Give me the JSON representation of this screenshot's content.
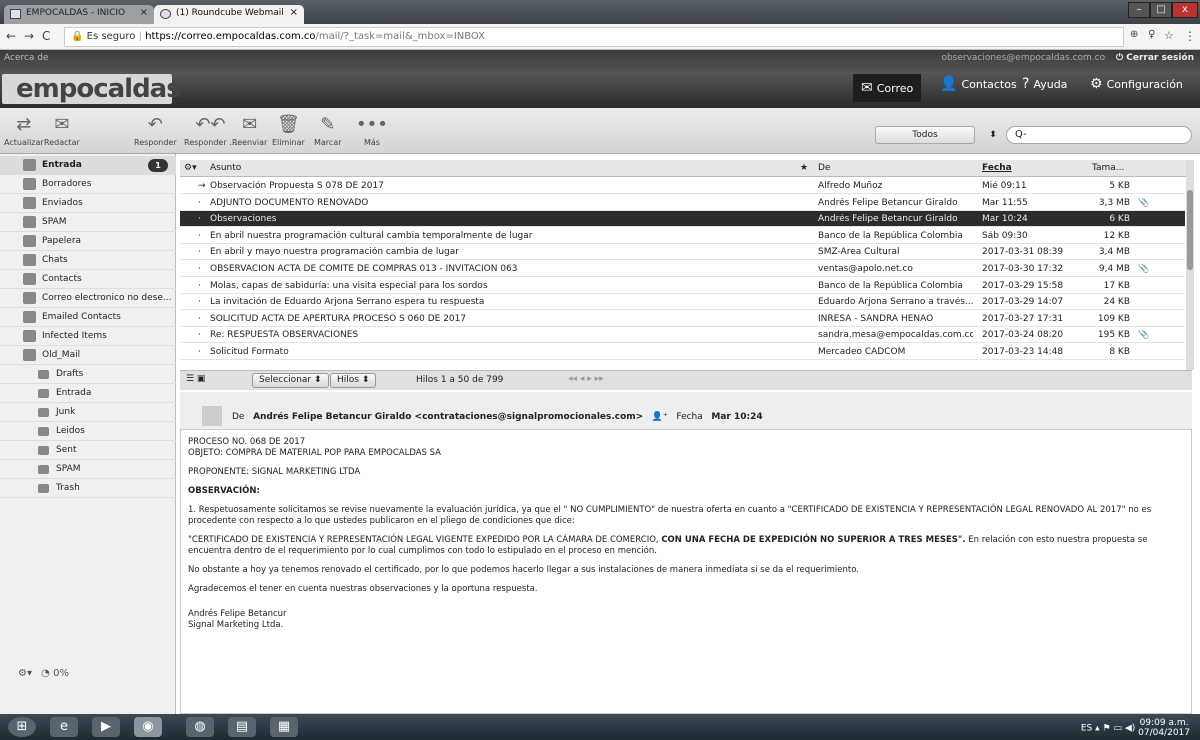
{
  "browser": {
    "tabs": [
      {
        "label": "EMPOCALDAS - INICIO"
      },
      {
        "label": "(1) Roundcube Webmail"
      }
    ],
    "secure_label": "Es seguro",
    "url_host": "https://correo.empocaldas.com.co",
    "url_path": "/mail/?_task=mail&_mbox=INBOX"
  },
  "header": {
    "about": "Acerca de",
    "user_email": "observaciones@empocaldas.com.co",
    "logout": "Cerrar sesión",
    "logo_text": "empocaldas",
    "nav": {
      "correo": "Correo",
      "contactos": "Contactos",
      "ayuda": "Ayuda",
      "config": "Configuración"
    }
  },
  "toolbar": {
    "actualizar": "Actualizar",
    "redactar": "Redactar",
    "responder": "Responder",
    "responder_todos": "Responder ...",
    "reenviar": "Reenviar",
    "eliminar": "Eliminar",
    "marcar": "Marcar",
    "mas": "Más",
    "filter": "Todos",
    "search_placeholder": "Q-"
  },
  "sidebar": {
    "folders": [
      {
        "label": "Entrada",
        "count": "1"
      },
      {
        "label": "Borradores"
      },
      {
        "label": "Enviados"
      },
      {
        "label": "SPAM"
      },
      {
        "label": "Papelera"
      },
      {
        "label": "Chats"
      },
      {
        "label": "Contacts"
      },
      {
        "label": "Correo electronico no dese..."
      },
      {
        "label": "Emailed Contacts"
      },
      {
        "label": "Infected Items"
      },
      {
        "label": "Old_Mail"
      }
    ],
    "subfolders": [
      {
        "label": "Drafts"
      },
      {
        "label": "Entrada"
      },
      {
        "label": "Junk"
      },
      {
        "label": "Leidos"
      },
      {
        "label": "Sent"
      },
      {
        "label": "SPAM"
      },
      {
        "label": "Trash"
      }
    ],
    "quota": "0%"
  },
  "list": {
    "headers": {
      "subject": "Asunto",
      "from": "De",
      "date": "Fecha",
      "size": "Tama..."
    },
    "rows": [
      {
        "subject": "Observación Propuesta S 078 DE 2017",
        "from": "Alfredo Muñoz",
        "date": "Mié 09:11",
        "size": "5 KB",
        "clip": ""
      },
      {
        "subject": "ADJUNTO DOCUMENTO RENOVADO",
        "from": "Andrés Felipe Betancur Giraldo",
        "date": "Mar 11:55",
        "size": "3,3 MB",
        "clip": "📎"
      },
      {
        "subject": "Observaciones",
        "from": "Andrés Felipe Betancur Giraldo",
        "date": "Mar 10:24",
        "size": "6 KB",
        "clip": ""
      },
      {
        "subject": "En abril nuestra programación cultural cambia temporalmente de lugar",
        "from": "Banco de la República Colombia",
        "date": "Sáb 09:30",
        "size": "12 KB",
        "clip": ""
      },
      {
        "subject": "En abril y mayo nuestra programación cambia de lugar",
        "from": "SMZ-Area Cultural",
        "date": "2017-03-31 08:39",
        "size": "3,4 MB",
        "clip": ""
      },
      {
        "subject": "OBSERVACION ACTA DE COMITE DE COMPRAS 013 - INVITACION 063",
        "from": "ventas@apolo.net.co",
        "date": "2017-03-30 17:32",
        "size": "9,4 MB",
        "clip": "📎"
      },
      {
        "subject": "Molas, capas de sabiduría: una visita especial para los sordos",
        "from": "Banco de la República Colombia",
        "date": "2017-03-29 15:58",
        "size": "17 KB",
        "clip": ""
      },
      {
        "subject": "La invitación de Eduardo Arjona Serrano espera tu respuesta",
        "from": "Eduardo Arjona Serrano a través...",
        "date": "2017-03-29 14:07",
        "size": "24 KB",
        "clip": ""
      },
      {
        "subject": "SOLICITUD ACTA DE APERTURA PROCESO S 060 DE 2017",
        "from": "INRESA - SANDRA HENAO",
        "date": "2017-03-27 17:31",
        "size": "109 KB",
        "clip": ""
      },
      {
        "subject": "Re: RESPUESTA OBSERVACIONES",
        "from": "sandra.mesa@empocaldas.com.co",
        "date": "2017-03-24 08:20",
        "size": "195 KB",
        "clip": "📎"
      },
      {
        "subject": "Solicitud Formato",
        "from": "Mercadeo CADCOM",
        "date": "2017-03-23 14:48",
        "size": "8 KB",
        "clip": ""
      }
    ],
    "footer": {
      "select": "Seleccionar",
      "threads": "Hilos",
      "count": "Hilos 1 a 50 de 799"
    }
  },
  "preview": {
    "from_label": "De",
    "from": "Andrés Felipe Betancur Giraldo <contrataciones@signalpromocionales.com>",
    "date_label": "Fecha",
    "date": "Mar 10:24",
    "body": [
      "PROCESO NO. 068 DE 2017",
      "OBJETO: COMPRA DE MATERIAL POP PARA EMPOCALDAS SA",
      "PROPONENTE: SIGNAL MARKETING LTDA",
      "OBSERVACIÓN:",
      "1. Respetuosamente solicitamos se revise nuevamente la evaluación jurídica, ya que el \" NO CUMPLIMIENTO\" de nuestra oferta en cuanto a \"CERTIFICADO DE EXISTENCIA Y REPRESENTACIÓN LEGAL RENOVADO AL 2017\" no es procedente con respecto a lo que ustedes publicaron en el pliego de condiciones que dice:",
      "\"CERTIFICADO DE EXISTENCIA Y REPRESENTACIÓN LEGAL VIGENTE EXPEDIDO POR LA CÁMARA DE COMERCIO,",
      "CON UNA FECHA DE EXPEDICIÓN NO SUPERIOR A TRES MESES\".",
      " En relación con esto nuestra propuesta se encuentra dentro de el requerimiento por lo cual cumplimos con todo lo estipulado en el proceso en mención.",
      "No obstante a hoy ya tenemos renovado el certificado, por lo que podemos hacerlo llegar a sus instalaciones de manera inmediata si se da el requerimiento.",
      "Agradecemos el tener en cuenta nuestras observaciones y la oportuna respuesta.",
      "Andrés Felipe Betancur",
      "Signal Marketing Ltda."
    ]
  },
  "taskbar": {
    "lang": "ES",
    "time": "09:09 a.m.",
    "date": "07/04/2017"
  }
}
